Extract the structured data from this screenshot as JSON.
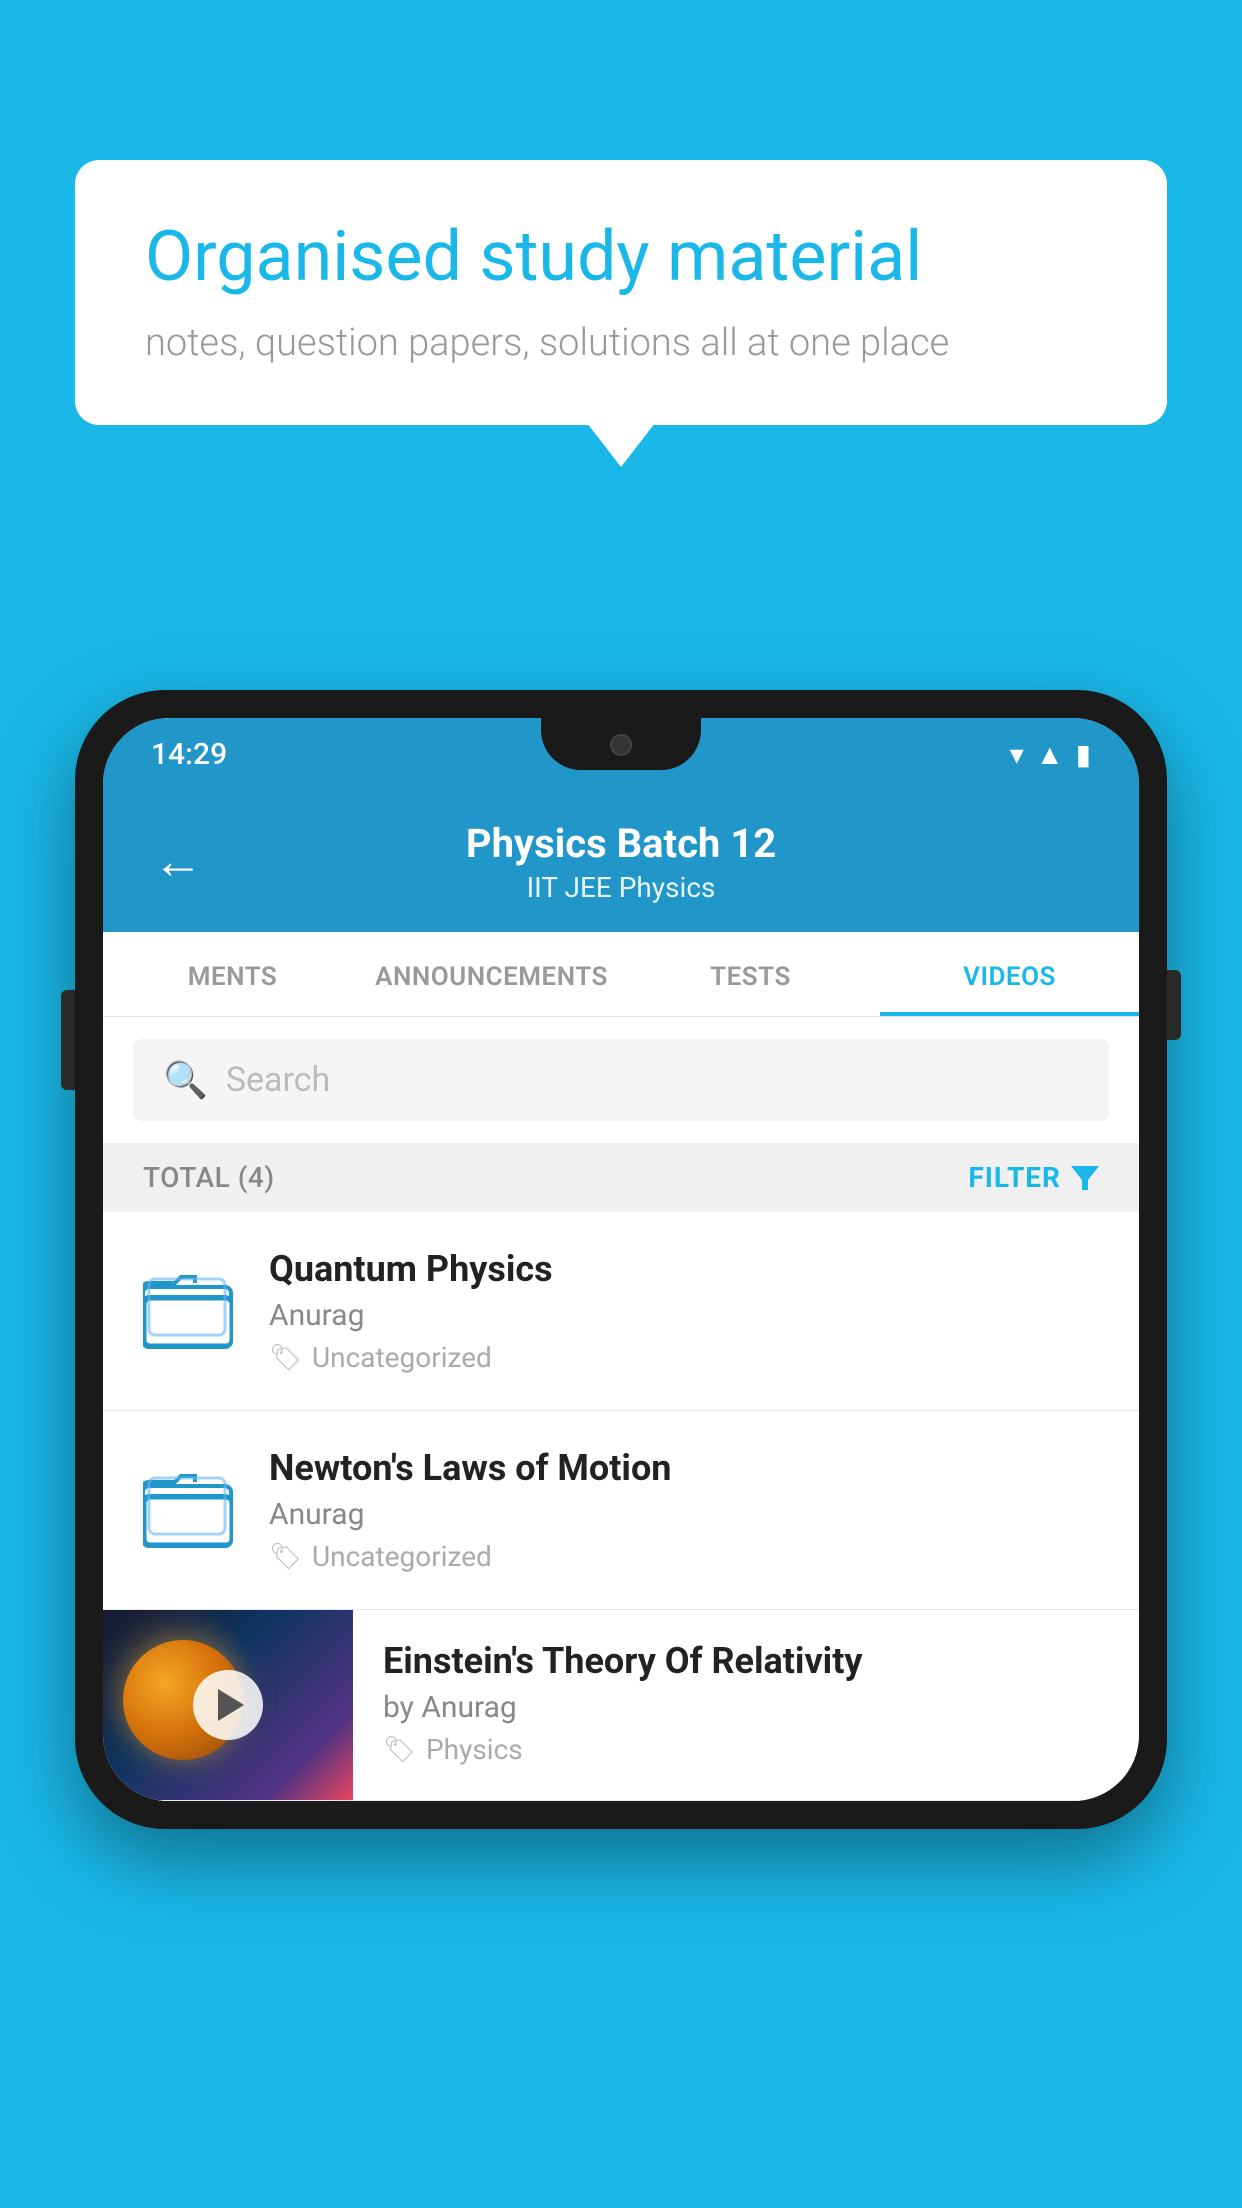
{
  "background_color": "#1ab8e8",
  "bubble": {
    "title": "Organised study material",
    "subtitle": "notes, question papers, solutions all at one place"
  },
  "status_bar": {
    "time": "14:29",
    "wifi_icon": "▼",
    "signal_icon": "▲",
    "battery_icon": "▮"
  },
  "header": {
    "back_label": "←",
    "title": "Physics Batch 12",
    "subtitle": "IIT JEE    Physics"
  },
  "tabs": [
    {
      "label": "MENTS",
      "active": false
    },
    {
      "label": "ANNOUNCEMENTS",
      "active": false
    },
    {
      "label": "TESTS",
      "active": false
    },
    {
      "label": "VIDEOS",
      "active": true
    }
  ],
  "search": {
    "placeholder": "Search"
  },
  "filter_bar": {
    "total_label": "TOTAL (4)",
    "filter_label": "FILTER"
  },
  "videos": [
    {
      "title": "Quantum Physics",
      "author": "Anurag",
      "tag": "Uncategorized",
      "has_thumbnail": false
    },
    {
      "title": "Newton's Laws of Motion",
      "author": "Anurag",
      "tag": "Uncategorized",
      "has_thumbnail": false
    },
    {
      "title": "Einstein's Theory Of Relativity",
      "author": "by Anurag",
      "tag": "Physics",
      "has_thumbnail": true
    }
  ]
}
